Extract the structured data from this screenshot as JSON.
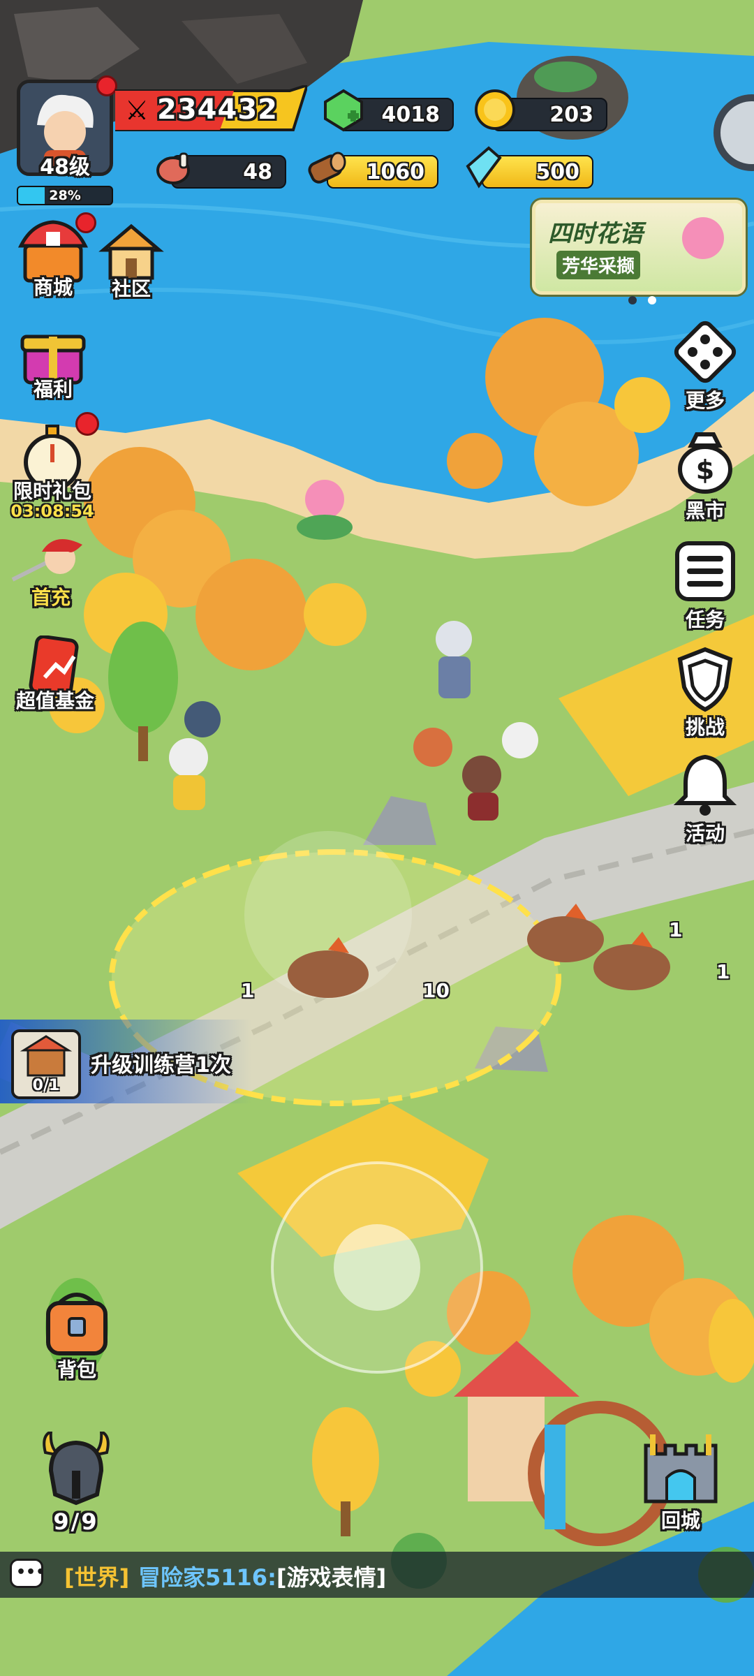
{
  "player": {
    "level": "48级",
    "xp_percent_label": "28%",
    "xp_fraction": 0.28,
    "power": "234432"
  },
  "resources": {
    "gems": "4018",
    "gold": "203",
    "meat": "48",
    "wood": "1060",
    "crystal": "500"
  },
  "event_banner": {
    "title": "四时花语",
    "subtitle": "芳华采撷"
  },
  "left_menu": {
    "shop": "商城",
    "community": "社区",
    "welfare": "福利",
    "limited_pack": "限时礼包",
    "limited_timer": "03:08:54",
    "first_recharge": "首充",
    "value_fund": "超值基金"
  },
  "right_menu": {
    "more": "更多",
    "black_market": "黑市",
    "tasks": "任务",
    "challenge": "挑战",
    "activity": "活动"
  },
  "quest": {
    "text": "升级训练营1次",
    "progress": "0/1"
  },
  "battle": {
    "enemy_counts": [
      "1",
      "10",
      "1",
      "1"
    ]
  },
  "bottom": {
    "backpack": "背包",
    "heroes_count": "9/9",
    "return_city": "回城"
  },
  "chat": {
    "channel": "[世界]",
    "sender": "冒险家5116:",
    "message": "[游戏表情]"
  },
  "colors": {
    "water": "#2fa7e6",
    "grass": "#9cc96a",
    "sand": "#f2d8a6",
    "autumn_orange": "#f0a23a",
    "autumn_yellow": "#f7c63a",
    "xp_bar": "#33c6f0",
    "red_dot": "#e8242c",
    "lightning": "#ffe14a"
  }
}
